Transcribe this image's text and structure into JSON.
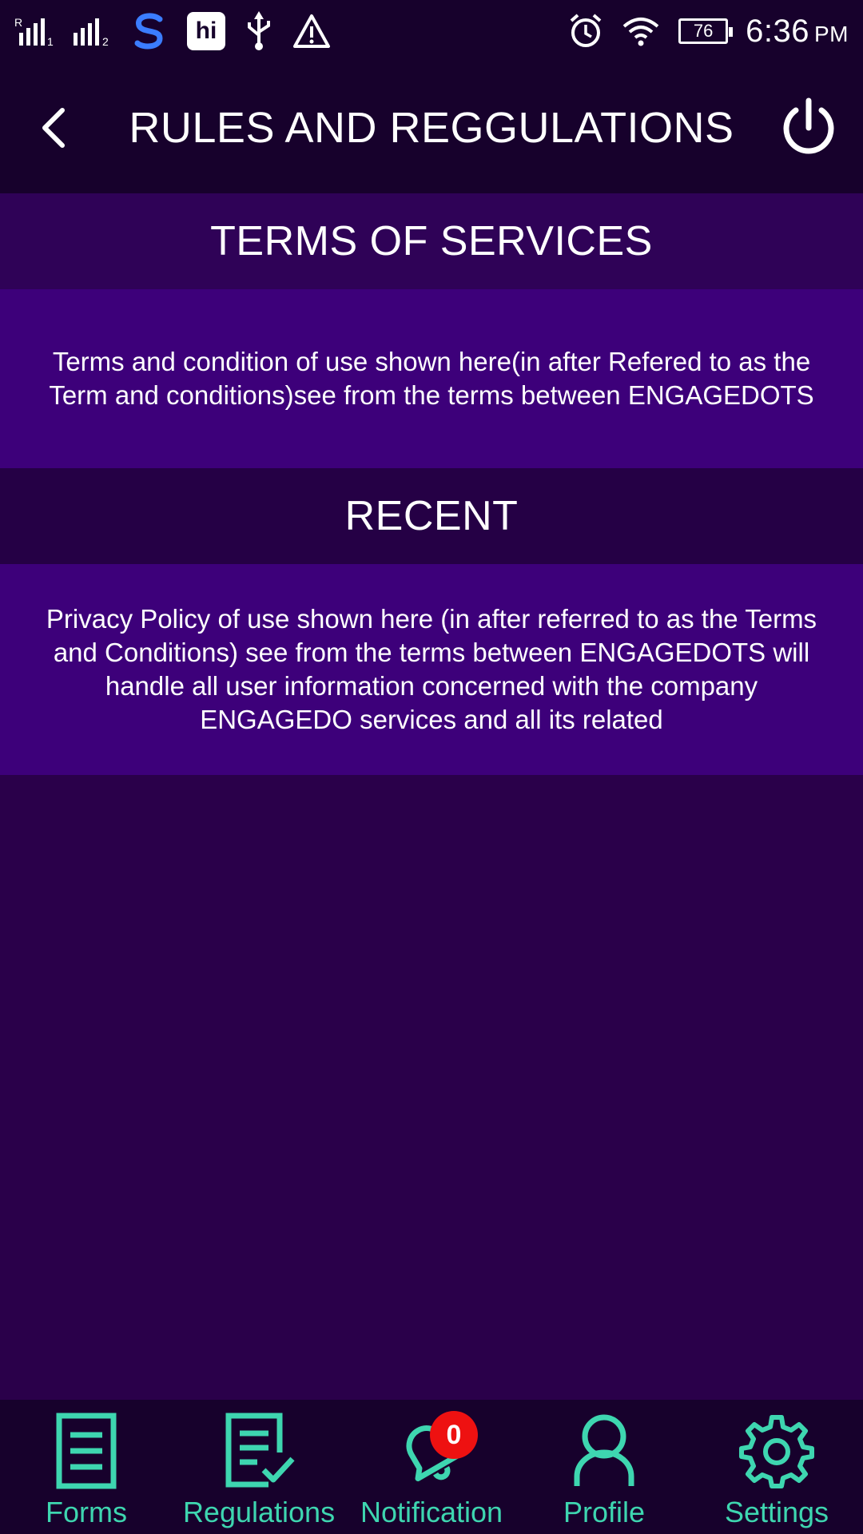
{
  "status_bar": {
    "time": "6:36",
    "ampm": "PM",
    "battery": "76",
    "app_badge": "hi",
    "icons": [
      "signal-r-icon",
      "signal-2-icon",
      "s-app-icon",
      "hi-app-icon",
      "usb-icon",
      "warning-icon",
      "alarm-icon",
      "wifi-icon",
      "battery-icon"
    ]
  },
  "header": {
    "title": "RULES AND REGGULATIONS",
    "back_icon": "chevron-left-icon",
    "power_icon": "power-icon"
  },
  "sections": {
    "terms": {
      "title": "TERMS OF SERVICES",
      "body": "Terms and condition of use shown here(in after Refered to as the Term and conditions)see from the terms between ENGAGEDOTS"
    },
    "recent": {
      "title": "RECENT",
      "body": "Privacy Policy of use shown here (in after referred to as the Terms and Conditions) see from the terms between ENGAGEDOTS will handle all user information concerned with the company ENGAGEDO services and all its related"
    }
  },
  "bottom_nav": {
    "items": [
      {
        "label": "Forms",
        "icon": "document-icon"
      },
      {
        "label": "Regulations",
        "icon": "checklist-icon"
      },
      {
        "label": "Notification",
        "icon": "bell-icon",
        "badge": "0"
      },
      {
        "label": "Profile",
        "icon": "user-icon"
      },
      {
        "label": "Settings",
        "icon": "gear-icon"
      }
    ]
  },
  "colors": {
    "background": "#2a004a",
    "bar": "#17012c",
    "accent": "#3ed6b0",
    "section_body": "#3d007a",
    "badge": "#ee1111"
  }
}
